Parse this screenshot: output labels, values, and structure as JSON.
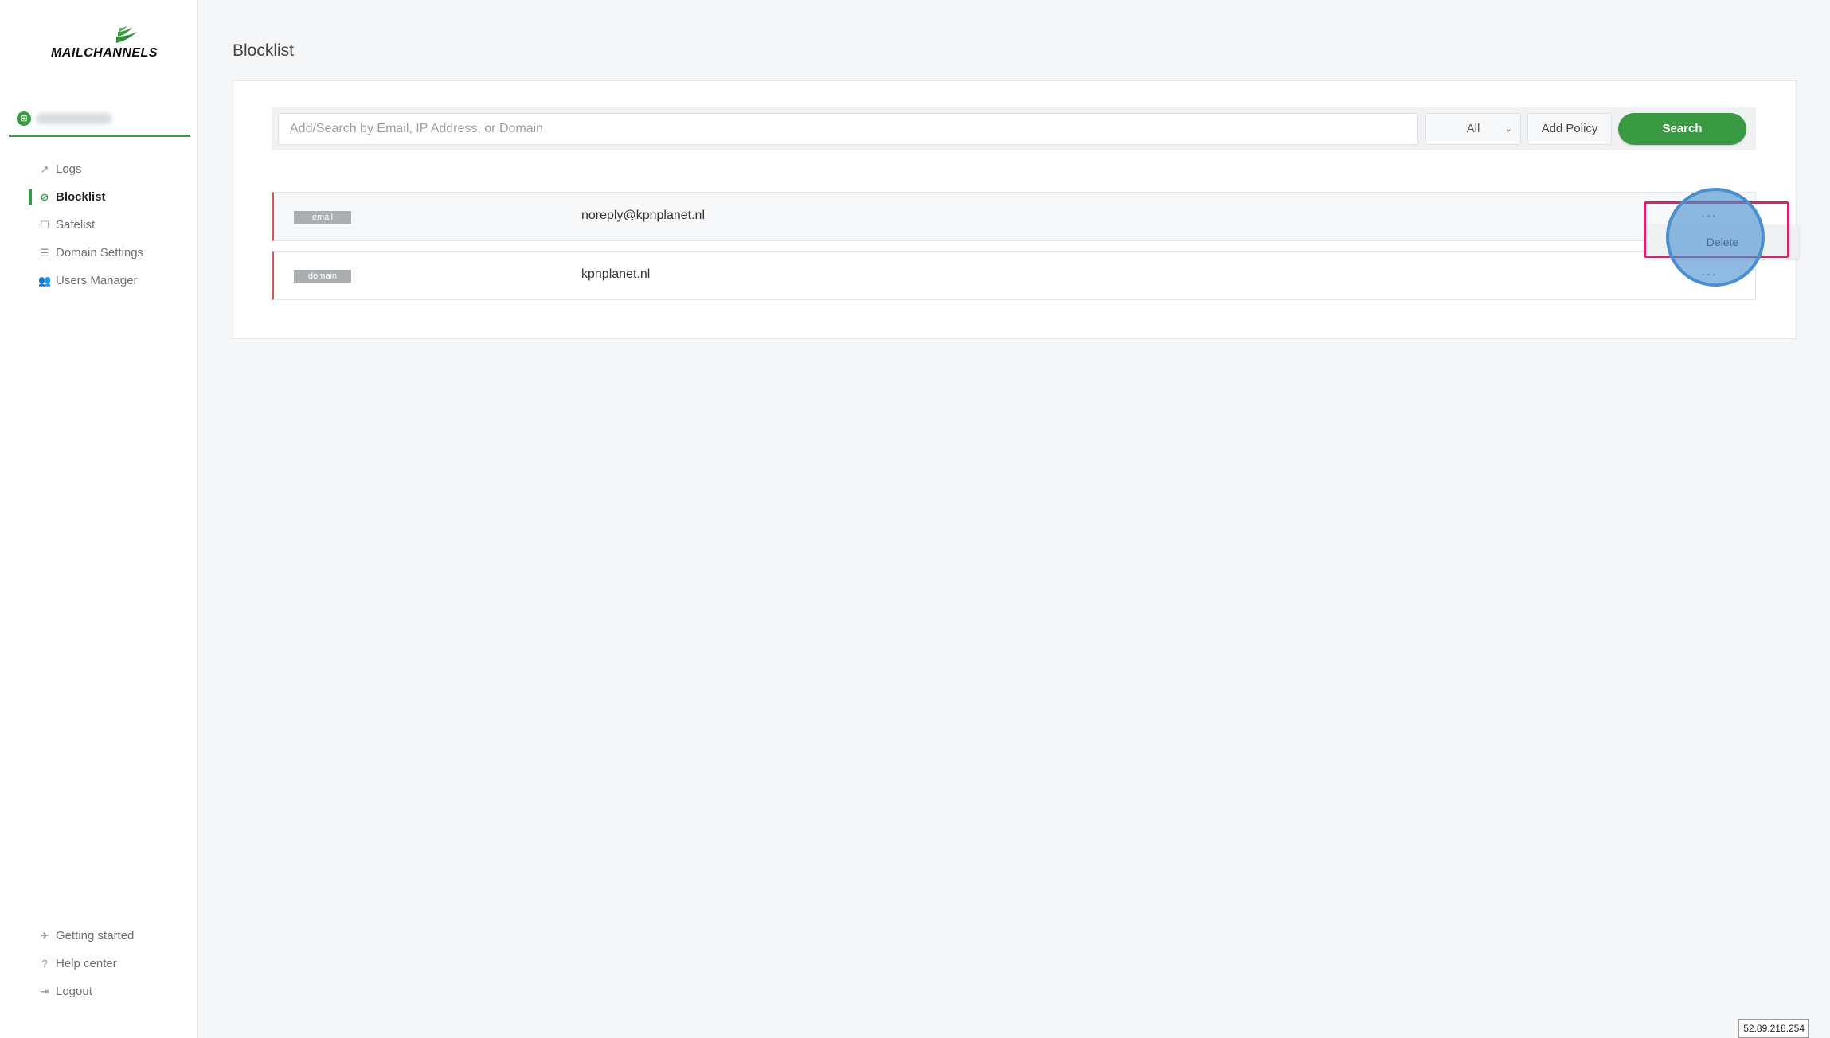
{
  "brand": {
    "name": "MAILCHANNELS"
  },
  "account": {
    "icon": "account-icon"
  },
  "sidebar": {
    "items": [
      {
        "label": "Logs",
        "icon": "logs-icon"
      },
      {
        "label": "Blocklist",
        "icon": "blocklist-icon",
        "active": true
      },
      {
        "label": "Safelist",
        "icon": "safelist-icon"
      },
      {
        "label": "Domain Settings",
        "icon": "domain-settings-icon"
      },
      {
        "label": "Users Manager",
        "icon": "users-icon"
      }
    ],
    "bottom": [
      {
        "label": "Getting started",
        "icon": "getting-started-icon"
      },
      {
        "label": "Help center",
        "icon": "help-icon"
      },
      {
        "label": "Logout",
        "icon": "logout-icon"
      }
    ]
  },
  "page": {
    "title": "Blocklist"
  },
  "toolbar": {
    "search_placeholder": "Add/Search by Email, IP Address, or Domain",
    "filter_value": "All",
    "add_policy_label": "Add Policy",
    "search_label": "Search"
  },
  "policies": [
    {
      "type": "email",
      "value": "noreply@kpnplanet.nl"
    },
    {
      "type": "domain",
      "value": "kpnplanet.nl"
    }
  ],
  "row_menu": {
    "label": "···",
    "delete_label": "Delete"
  },
  "footer": {
    "ip": "52.89.218.254"
  },
  "colors": {
    "accent": "#3a9a44",
    "row_marker": "#d9534f",
    "highlight": "#d8226b",
    "click_indicator": "#4a8fd0"
  }
}
